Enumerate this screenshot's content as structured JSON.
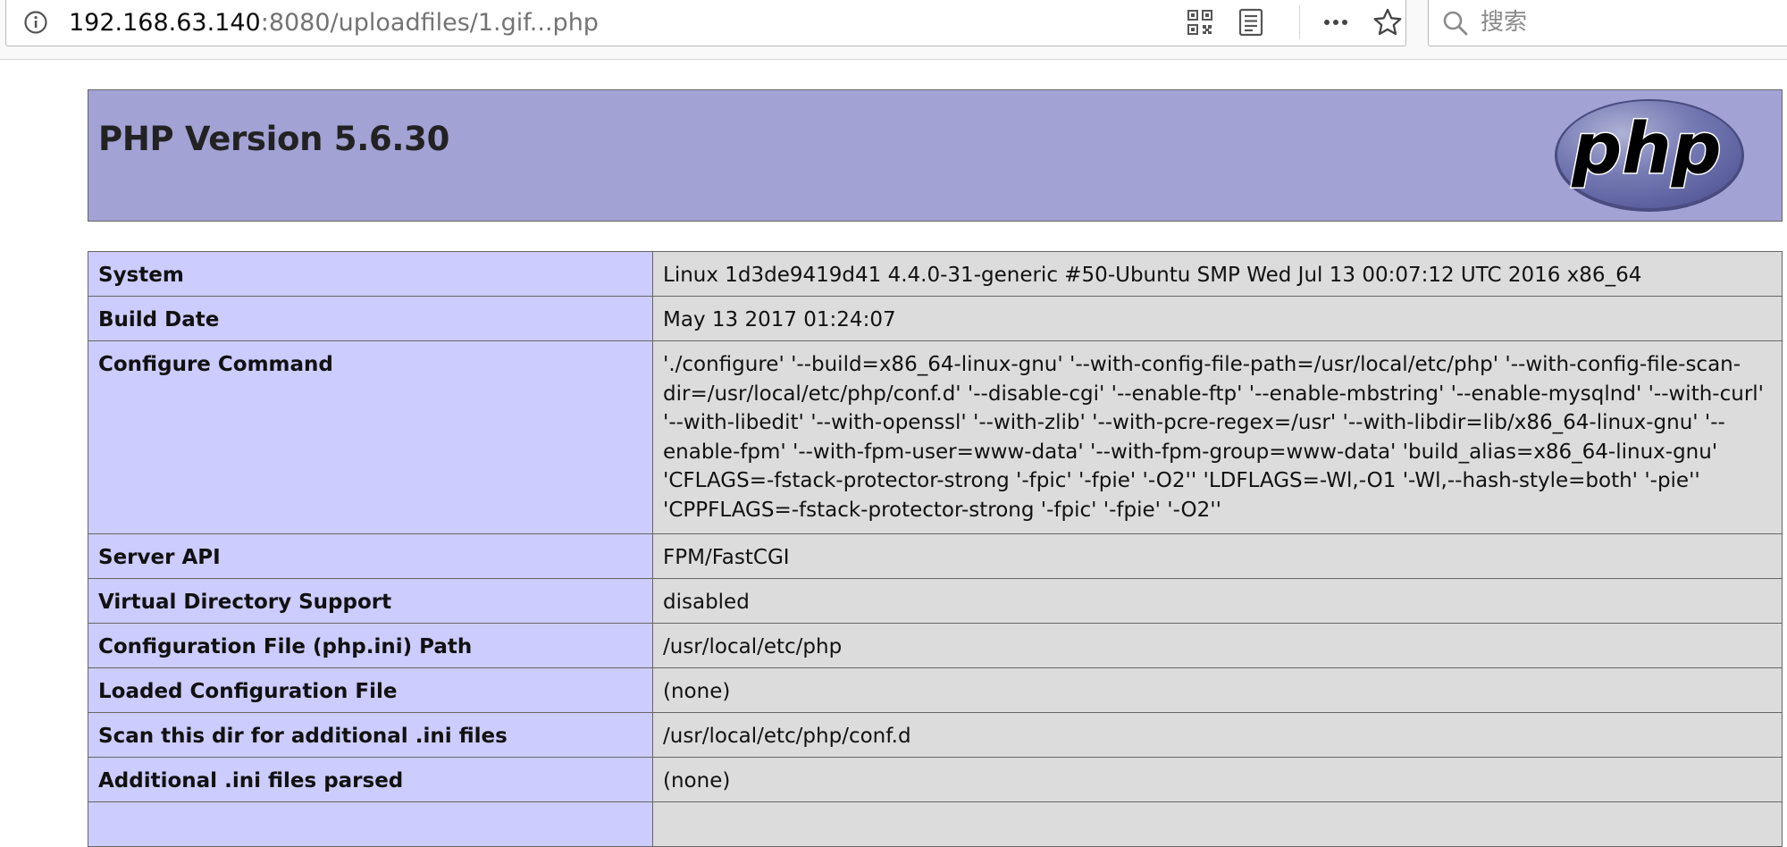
{
  "browser": {
    "url_host": "192.168.63.140",
    "url_path": ":8080/uploadfiles/1.gif...php",
    "search_placeholder": "搜索"
  },
  "phpinfo": {
    "title": "PHP Version 5.6.30",
    "logo_text": "php",
    "rows": [
      {
        "key": "System",
        "value": "Linux 1d3de9419d41 4.4.0-31-generic #50-Ubuntu SMP Wed Jul 13 00:07:12 UTC 2016 x86_64"
      },
      {
        "key": "Build Date",
        "value": "May 13 2017 01:24:07"
      },
      {
        "key": "Configure Command",
        "value": "'./configure' '--build=x86_64-linux-gnu' '--with-config-file-path=/usr/local/etc/php' '--with-config-file-scan-dir=/usr/local/etc/php/conf.d' '--disable-cgi' '--enable-ftp' '--enable-mbstring' '--enable-mysqlnd' '--with-curl' '--with-libedit' '--with-openssl' '--with-zlib' '--with-pcre-regex=/usr' '--with-libdir=lib/x86_64-linux-gnu' '--enable-fpm' '--with-fpm-user=www-data' '--with-fpm-group=www-data' 'build_alias=x86_64-linux-gnu' 'CFLAGS=-fstack-protector-strong '-fpic' '-fpie' '-O2'' 'LDFLAGS=-Wl,-O1 '-Wl,--hash-style=both' '-pie'' 'CPPFLAGS=-fstack-protector-strong '-fpic' '-fpie' '-O2''"
      },
      {
        "key": "Server API",
        "value": "FPM/FastCGI"
      },
      {
        "key": "Virtual Directory Support",
        "value": "disabled"
      },
      {
        "key": "Configuration File (php.ini) Path",
        "value": "/usr/local/etc/php"
      },
      {
        "key": "Loaded Configuration File",
        "value": "(none)"
      },
      {
        "key": "Scan this dir for additional .ini files",
        "value": "/usr/local/etc/php/conf.d"
      },
      {
        "key": "Additional .ini files parsed",
        "value": "(none)"
      },
      {
        "key": "",
        "value": ""
      }
    ]
  },
  "colors": {
    "header_bg": "#a2a2d5",
    "key_cell_bg": "#ccccff",
    "value_cell_bg": "#dcdcdc",
    "border": "#666666",
    "logo_fill": "#6c6eb5"
  }
}
